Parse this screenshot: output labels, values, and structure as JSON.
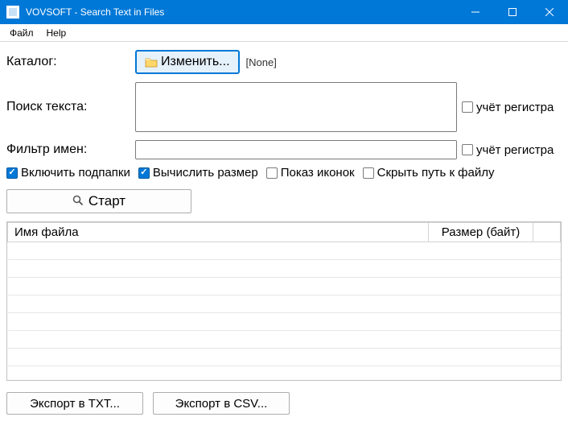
{
  "window": {
    "title": "VOVSOFT - Search Text in Files"
  },
  "menu": {
    "file": "Файл",
    "help": "Help"
  },
  "labels": {
    "catalog": "Каталог:",
    "search_text": "Поиск текста:",
    "name_filter": "Фильтр имен:"
  },
  "catalog": {
    "change_button": "Изменить...",
    "path_display": "[None]"
  },
  "inputs": {
    "search_text_value": "",
    "name_filter_value": ""
  },
  "checkboxes": {
    "text_case": "учёт регистра",
    "filter_case": "учёт регистра",
    "include_subfolders": "Включить подпапки",
    "compute_size": "Вычислить размер",
    "show_icons": "Показ иконок",
    "hide_path": "Скрыть путь к файлу"
  },
  "buttons": {
    "start": "Старт",
    "export_txt": "Экспорт в ТХТ...",
    "export_csv": "Экспорт в CSV..."
  },
  "table": {
    "col_filename": "Имя файла",
    "col_size": "Размер (байт)"
  }
}
